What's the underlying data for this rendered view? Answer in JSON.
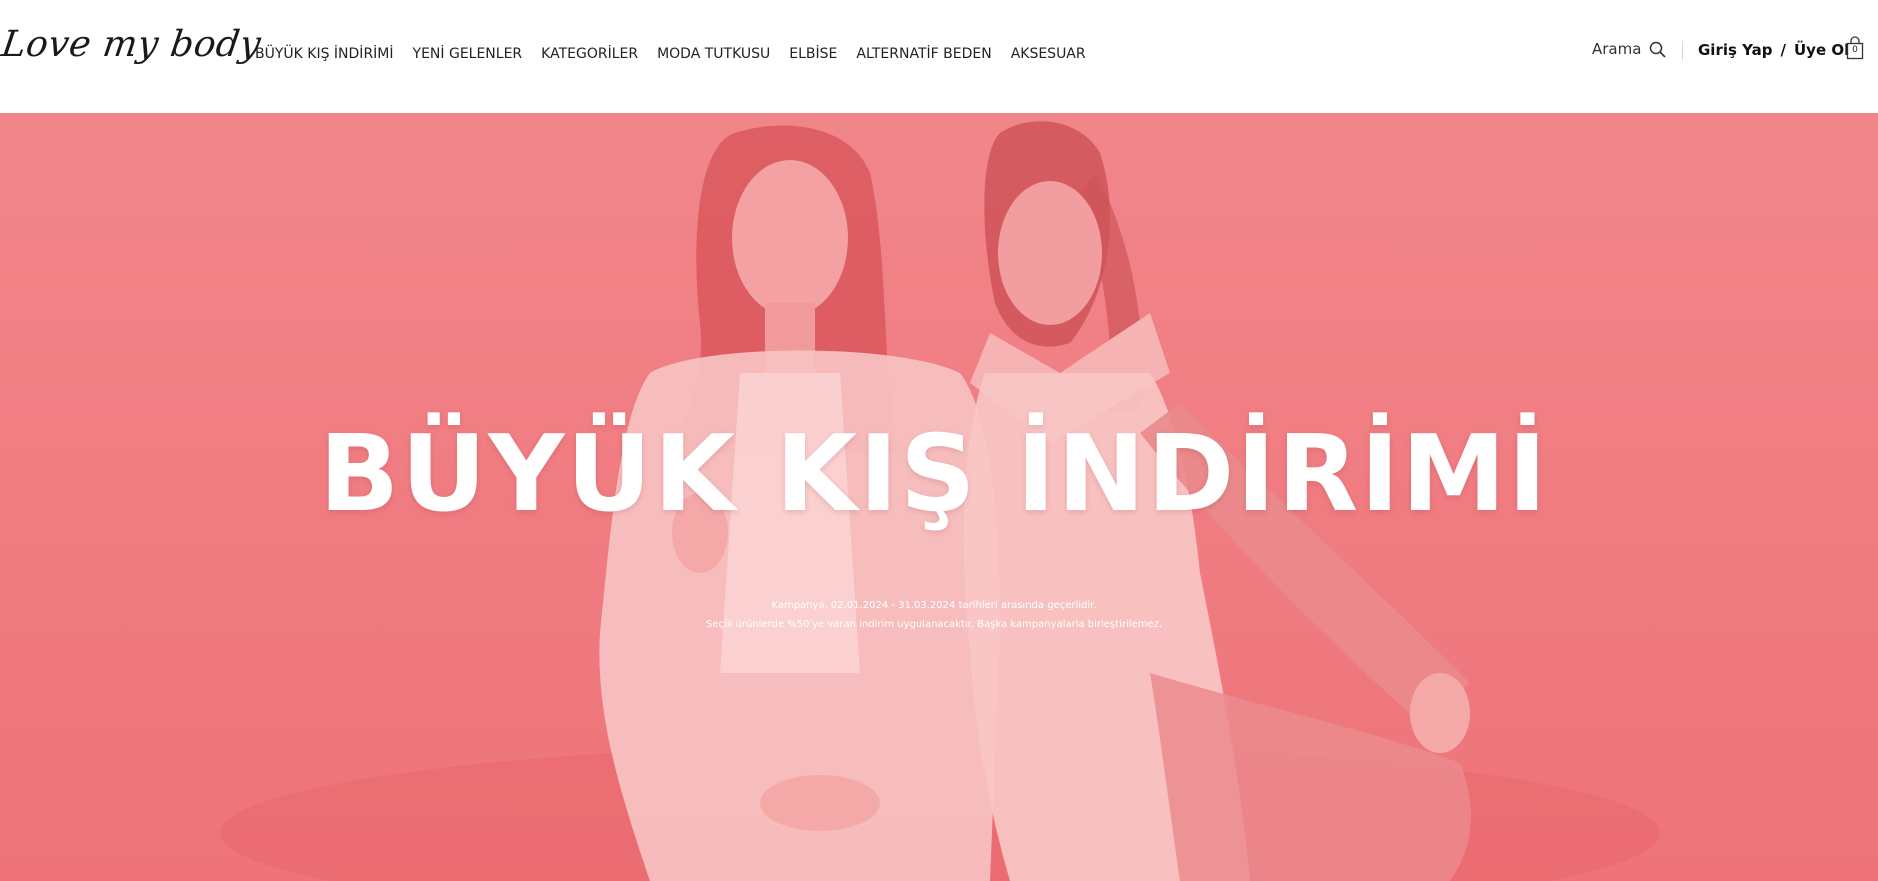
{
  "header": {
    "logo": "Love my body",
    "nav": [
      "BÜYÜK KIŞ İNDİRİMİ",
      "YENİ GELENLER",
      "KATEGORİLER",
      "MODA TUTKUSU",
      "ELBİSE",
      "ALTERNATİF BEDEN",
      "AKSESUAR"
    ],
    "search_label": "Arama",
    "login": "Giriş Yap",
    "separator": "/",
    "register": "Üye Ol",
    "cart_count": "0"
  },
  "hero": {
    "title": "BÜYÜK KIŞ İNDİRİMİ",
    "line1": "Kampanya, 02.01.2024 - 31.03.2024 tarihleri arasında geçerlidir.",
    "line2": "Seçili ürünlerde %50'ye varan indirim uygulanacaktır. Başka kampanyalarla birleştirilemez.",
    "overlay_color": "#f07e83"
  }
}
